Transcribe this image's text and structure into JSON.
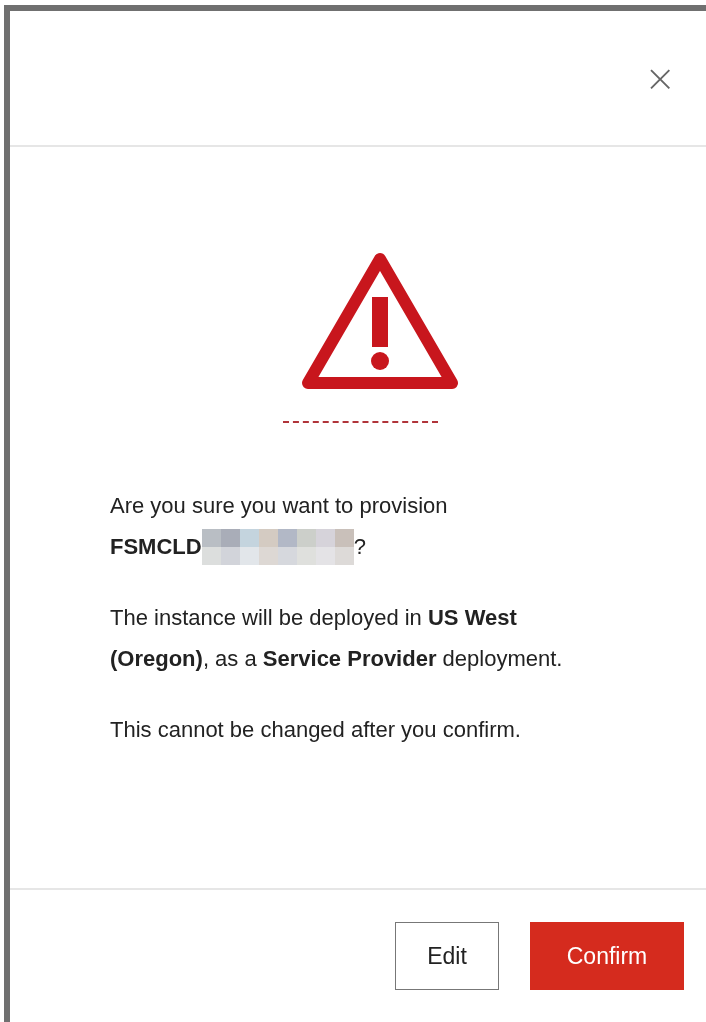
{
  "dialog": {
    "close_icon": "×",
    "messages": [
      {
        "kind": "target",
        "text": "Are you sure you want to provision",
        "name": "FSMCLD",
        "redacted": true,
        "suffix": "?"
      },
      {
        "kind": "text",
        "text": "The instance will be deployed in **US West (Oregon)**, as a **Service Provider** deployment."
      },
      {
        "kind": "text",
        "text": "This cannot be changed after you confirm."
      }
    ],
    "buttons": [
      {
        "label": "Edit",
        "kind": "secondary"
      },
      {
        "label": "Confirm",
        "kind": "primary"
      }
    ]
  }
}
